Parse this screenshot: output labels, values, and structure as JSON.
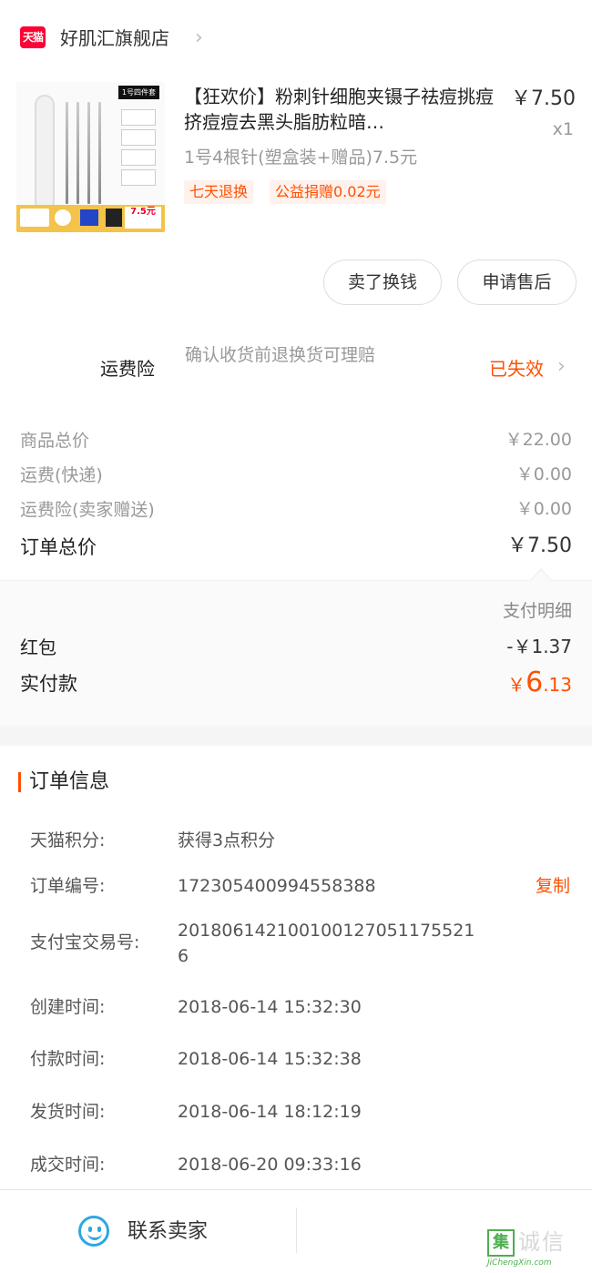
{
  "store": {
    "badge": "天猫",
    "name": "好肌汇旗舰店"
  },
  "product": {
    "image_tag": "1号四件套",
    "image_price": "7.5元",
    "title": "【狂欢价】粉刺针细胞夹镊子祛痘挑痘挤痘痘去黑头脂肪粒暗…",
    "price": "￥7.50",
    "qty": "x1",
    "sku": "1号4根针(塑盒装+赠品)7.5元",
    "tags": [
      "七天退换",
      "公益捐赠0.02元"
    ]
  },
  "actions": {
    "sell": "卖了换钱",
    "after_sale": "申请售后"
  },
  "insurance": {
    "label": "运费险",
    "desc": "确认收货前退换货可理赔",
    "status": "已失效"
  },
  "summary": {
    "rows": [
      {
        "label": "商品总价",
        "value": "￥22.00"
      },
      {
        "label": "运费(快递)",
        "value": "￥0.00"
      },
      {
        "label": "运费险(卖家赠送)",
        "value": "￥0.00"
      }
    ],
    "total_label": "订单总价",
    "total_value": "￥7.50"
  },
  "payment": {
    "detail_link": "支付明细",
    "redpacket_label": "红包",
    "redpacket_value": "-￥1.37",
    "paid_label": "实付款",
    "paid_symbol": "￥",
    "paid_int": "6",
    "paid_dec": ".13"
  },
  "order_info": {
    "title": "订单信息",
    "copy": "复制",
    "rows": [
      {
        "label": "天猫积分:",
        "value": "获得3点积分"
      },
      {
        "label": "订单编号:",
        "value": "172305400994558388"
      },
      {
        "label": "支付宝交易号:",
        "value": "2018061421001001270511755216"
      },
      {
        "label": "创建时间:",
        "value": "2018-06-14 15:32:30"
      },
      {
        "label": "付款时间:",
        "value": "2018-06-14 15:32:38"
      },
      {
        "label": "发货时间:",
        "value": "2018-06-14 18:12:19"
      },
      {
        "label": "成交时间:",
        "value": "2018-06-20 09:33:16"
      }
    ]
  },
  "bottom": {
    "contact": "联系卖家"
  },
  "watermark": {
    "box": "集",
    "text": "诚信",
    "url": "JiChengXin.com"
  },
  "colors": {
    "accent": "#ff5000",
    "tmall": "#ff0036",
    "contact": "#2ea7e0"
  }
}
